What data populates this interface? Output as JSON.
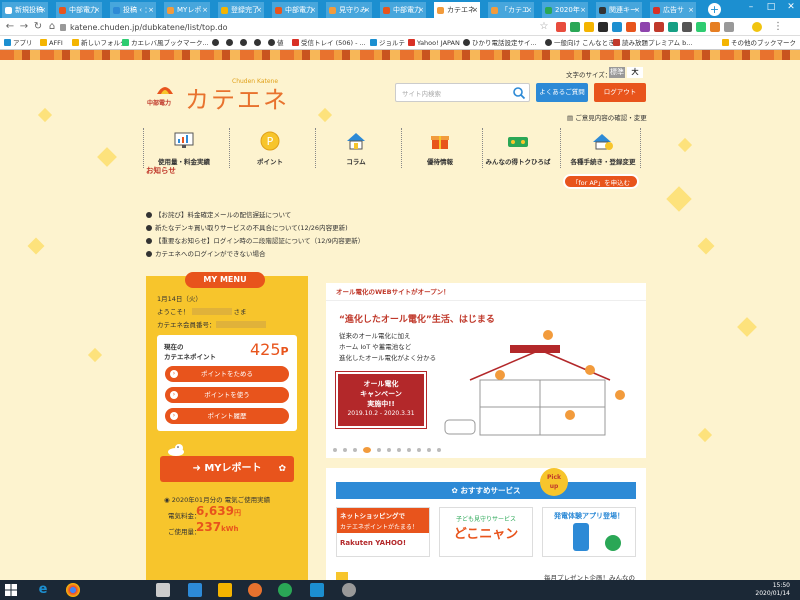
{
  "browser": {
    "tabs": [
      {
        "label": "新規投稿"
      },
      {
        "label": "中部電力"
      },
      {
        "label": "投稿 ‹ ："
      },
      {
        "label": "MYレポ"
      },
      {
        "label": "登録完了"
      },
      {
        "label": "中部電力"
      },
      {
        "label": "見守りみ"
      },
      {
        "label": "中部電力"
      },
      {
        "label": "カテエネ"
      },
      {
        "label": "「カテエ"
      },
      {
        "label": "2020年"
      },
      {
        "label": "関連キー"
      },
      {
        "label": "広告サ"
      }
    ],
    "new_tab": "+",
    "url": "katene.chuden.jp/dubkatene/list/top.do",
    "bookmarks": [
      "アプリ",
      "AFFI",
      "新しいフォルダ",
      "カエレバ風ブックマーク...",
      "",
      "",
      "",
      "",
      "",
      "値",
      "受信トレイ (506) - ...",
      "ジョルテ",
      "Yahoo! JAPAN",
      "ひかり電話設定サイ...",
      "一般向け こんなとき...",
      "読み放題プレミアム b...",
      "その他のブックマーク"
    ]
  },
  "header": {
    "company": "中部電力",
    "logo": "カテエネ",
    "logo_sup": "Chuden Katene",
    "font_size_label": "文字のサイズ：",
    "font_std": "標準",
    "font_large": "大",
    "search_placeholder": "サイト内検索",
    "faq": "よくあるご質問",
    "logout": "ログアウト",
    "terms": "ご意見内容の確認・変更"
  },
  "nav": [
    {
      "label": "使用量・料金実績"
    },
    {
      "label": "ポイント"
    },
    {
      "label": "コラム"
    },
    {
      "label": "優待情報"
    },
    {
      "label": "みんなの得トクひろば"
    },
    {
      "label": "各種手続き・登録変更"
    }
  ],
  "nav_extra": {
    "forap_button": "「for AP」を申込む"
  },
  "news": {
    "heading": "お知らせ",
    "items": [
      "【お詫び】料金確定メールの配信遅延について",
      "新たなデンキ買い取りサービスの不具合について(12/26内容更新)",
      "【重要なお知らせ】ログイン時の二段階認証について（12/9内容更新）",
      "カテエネへのログインができない場合"
    ]
  },
  "mymenu": {
    "title": "MY MENU",
    "date": "1月14日（火）",
    "welcome": "ようこそ！",
    "welcome_suffix": "さま",
    "member_label": "カテエネ会員番号：",
    "point_label_1": "現在の",
    "point_label_2": "カテエネポイント",
    "points": "425",
    "points_unit": "P",
    "buttons": [
      "ポイントをためる",
      "ポイントを使う",
      "ポイント履歴"
    ],
    "report": "MYレポート",
    "usage_title": "2020年01月分の 電気ご使用実績",
    "bill_label": "電気料金：",
    "bill": "6,639",
    "bill_unit": "円",
    "usage_label": "ご使用量：",
    "usage": "237",
    "usage_unit": "kWh"
  },
  "banner": {
    "head": "オール電化のWEBサイトがオープン！",
    "title": "“進化したオール電化”生活、はじまる",
    "lines": [
      "従来のオール電化に加え",
      "ホーム IoT や蓄電池など",
      "進化したオール電化がよく分かる"
    ],
    "campaign": [
      "オール電化",
      "キャンペーン",
      "実施中!!",
      "2019.10.2 - 2020.3.31"
    ]
  },
  "recommend": {
    "title": "おすすめサービス",
    "pickup": [
      "Pick",
      "up"
    ],
    "cards": [
      {
        "title": "ネットショッピングで",
        "sub": "カテエネポイントがたまる！",
        "brand": "Rakuten  YAHOO!"
      },
      {
        "title": "子ども見守りサービス",
        "sub": "どこニャン",
        "brand": ""
      },
      {
        "title": "発電体験アプリ登場！",
        "sub": "",
        "brand": ""
      }
    ],
    "partial": "毎月プレゼント企画！みんなの"
  },
  "taskbar": {
    "time": "15:50",
    "date": "2020/01/14"
  },
  "colors": {
    "accent": "#e8541c",
    "blue": "#2d8ad6",
    "yellow": "#f7c52c",
    "bg": "#fdf3cf"
  }
}
